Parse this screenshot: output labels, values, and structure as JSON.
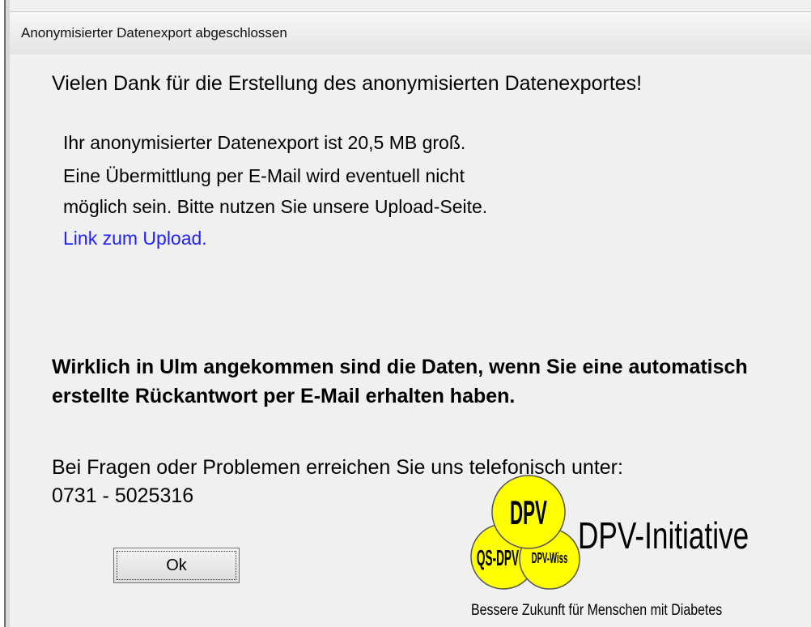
{
  "window": {
    "title": "Anonymisierter Datenexport abgeschlossen"
  },
  "message": {
    "thanks": "Vielen Dank für die Erstellung des anonymisierten Datenexportes!",
    "size_line": "Ihr anonymisierter Datenexport ist 20,5 MB groß.",
    "email_line1": "Eine Übermittlung per E-Mail wird eventuell nicht",
    "email_line2": "möglich sein. Bitte nutzen Sie unsere Upload-Seite.",
    "upload_link": "Link zum Upload.",
    "confirmation": "Wirklich in Ulm angekommen sind die Daten, wenn Sie eine automatisch erstellte Rückantwort per E-Mail erhalten haben.",
    "contact_line": "Bei Fragen oder Problemen erreichen Sie uns  telefonisch unter:",
    "phone": "0731 - 5025316"
  },
  "buttons": {
    "ok_label": "Ok"
  },
  "logo": {
    "circle_top": "DPV",
    "circle_left": "QS-DPV",
    "circle_right": "DPV-Wiss",
    "brand": "DPV-Initiative",
    "tagline": "Bessere Zukunft für Menschen mit Diabetes",
    "circle_color": "#ffff00",
    "stroke_color": "#555555"
  },
  "colors": {
    "link": "#1f1fff",
    "background": "#f0f0f0"
  }
}
